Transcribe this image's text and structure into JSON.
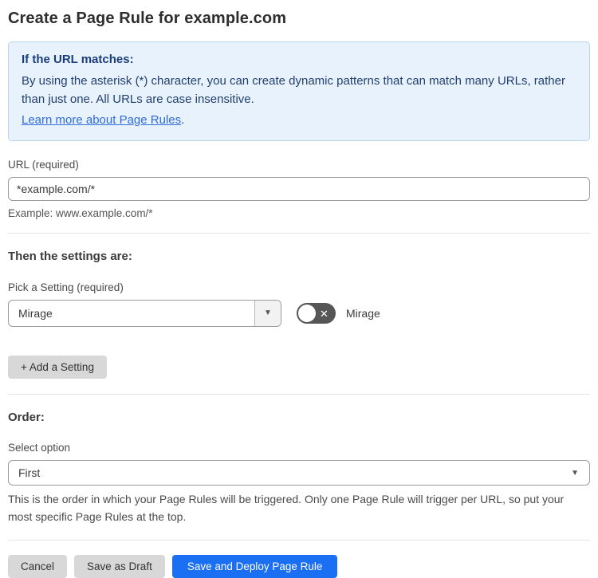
{
  "page": {
    "title": "Create a Page Rule for example.com"
  },
  "info_box": {
    "heading": "If the URL matches:",
    "body": "By using the asterisk (*) character, you can create dynamic patterns that can match many URLs, rather than just one. All URLs are case insensitive.",
    "link_label": "Learn more about Page Rules",
    "link_suffix": "."
  },
  "url_field": {
    "label": "URL (required)",
    "value": "*example.com/*",
    "helper": "Example: www.example.com/*"
  },
  "settings_section": {
    "heading": "Then the settings are:",
    "setting_label": "Pick a Setting (required)",
    "setting_value": "Mirage",
    "toggle_label": "Mirage",
    "toggle_state": "off",
    "toggle_x_glyph": "✕",
    "caret_glyph": "▼",
    "add_setting_label": "+ Add a Setting"
  },
  "order_section": {
    "heading": "Order:",
    "select_label": "Select option",
    "select_value": "First",
    "caret_glyph": "▼",
    "helper": "This is the order in which your Page Rules will be triggered. Only one Page Rule will trigger per URL, so put your most specific Page Rules at the top."
  },
  "footer": {
    "cancel_label": "Cancel",
    "save_draft_label": "Save as Draft",
    "save_deploy_label": "Save and Deploy Page Rule"
  },
  "colors": {
    "accent_blue": "#1a6ff2",
    "info_bg": "#e8f2fc",
    "info_border": "#b9d3ec",
    "info_text": "#22406e",
    "link_blue": "#2e6bd9",
    "toggle_off_bg": "#565656",
    "gray_button_bg": "#d8d8d8"
  }
}
